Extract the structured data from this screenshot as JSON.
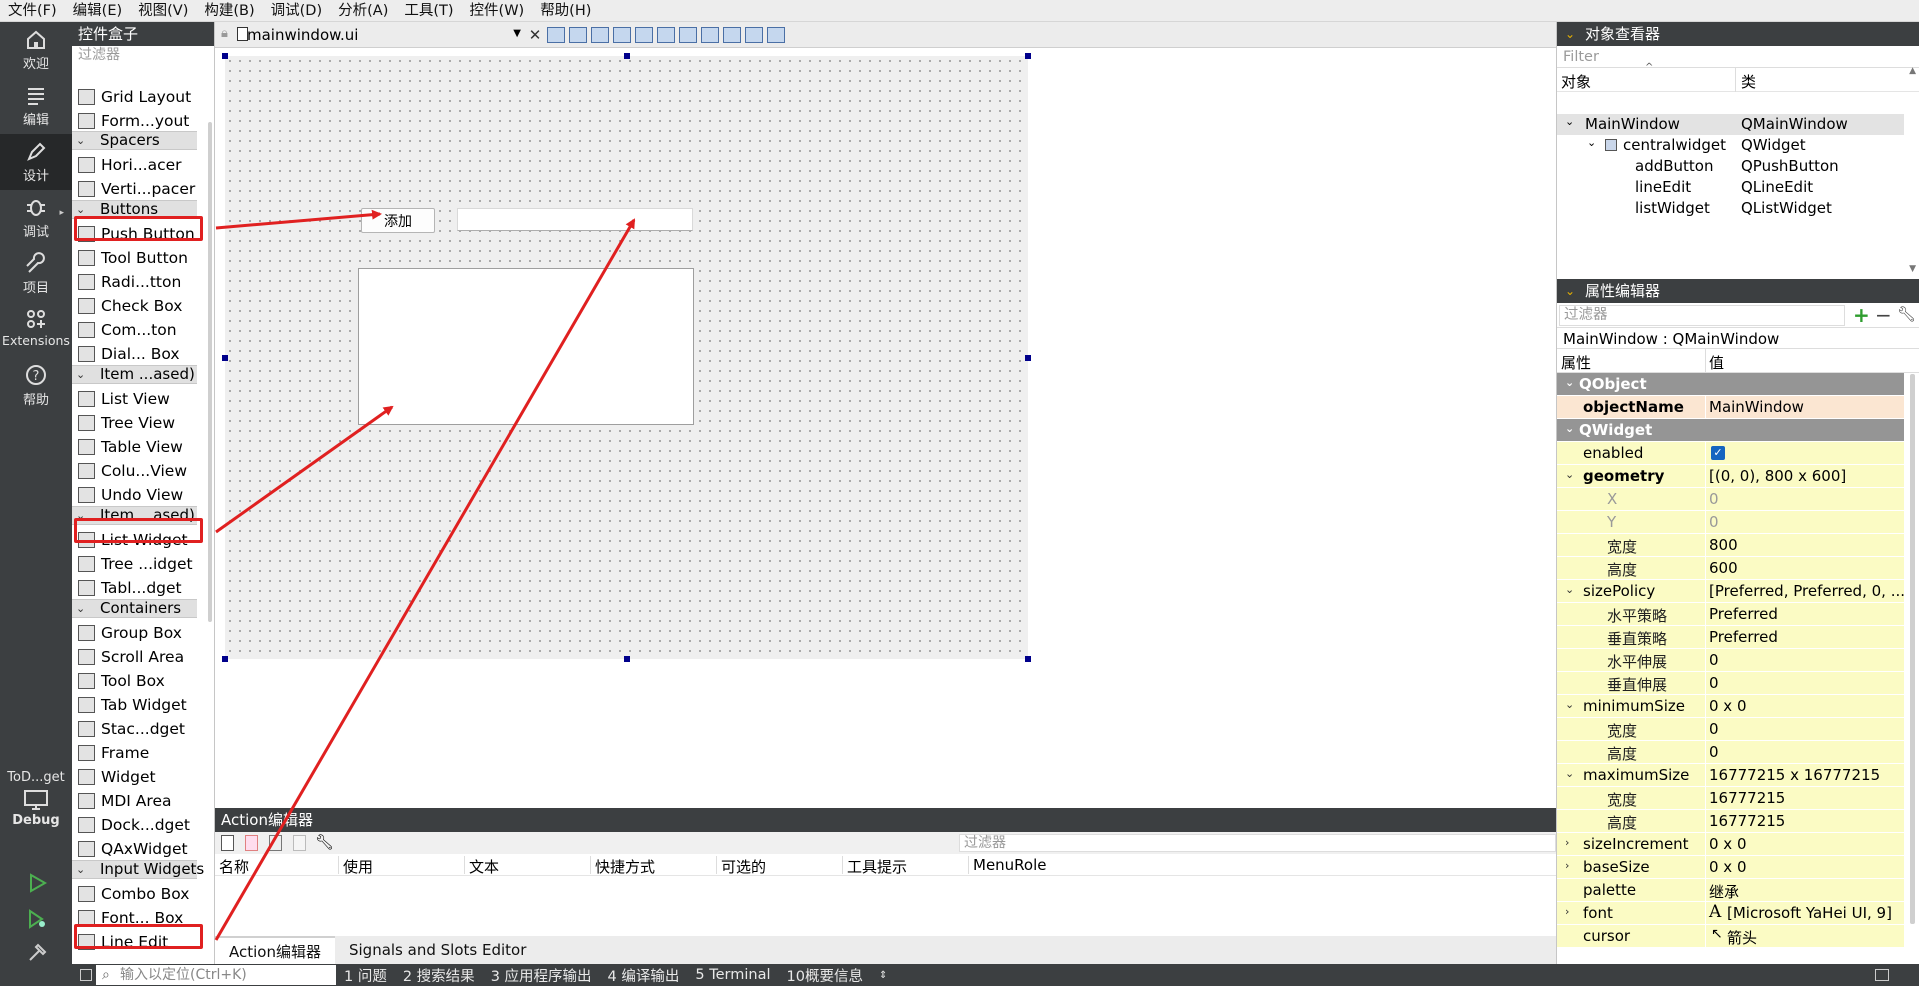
{
  "menubar": [
    "文件(F)",
    "编辑(E)",
    "视图(V)",
    "构建(B)",
    "调试(D)",
    "分析(A)",
    "工具(T)",
    "控件(W)",
    "帮助(H)"
  ],
  "modes": [
    {
      "label": "欢迎",
      "icon": "home-icon"
    },
    {
      "label": "编辑",
      "icon": "edit-lines-icon"
    },
    {
      "label": "设计",
      "icon": "pen-icon"
    },
    {
      "label": "调试",
      "icon": "bug-icon"
    },
    {
      "label": "项目",
      "icon": "wrench-icon"
    },
    {
      "label": "Extensions",
      "icon": "extensions-icon"
    },
    {
      "label": "帮助",
      "icon": "help-icon"
    }
  ],
  "kit": {
    "project": "ToD...get",
    "label": "Debug"
  },
  "widget_box": {
    "title": "控件盒子",
    "filter_placeholder": "过滤器",
    "items": [
      {
        "type": "item",
        "label": "Grid Layout",
        "icon": "grid-layout-icon"
      },
      {
        "type": "item",
        "label": "Form...yout",
        "icon": "form-layout-icon"
      },
      {
        "type": "cat",
        "label": "Spacers"
      },
      {
        "type": "item",
        "label": "Hori...acer",
        "icon": "horizontal-spacer-icon"
      },
      {
        "type": "item",
        "label": "Verti...pacer",
        "icon": "vertical-spacer-icon"
      },
      {
        "type": "cat",
        "label": "Buttons"
      },
      {
        "type": "item",
        "label": "Push Button",
        "icon": "push-button-icon"
      },
      {
        "type": "item",
        "label": "Tool Button",
        "icon": "tool-button-icon"
      },
      {
        "type": "item",
        "label": "Radi...tton",
        "icon": "radio-button-icon"
      },
      {
        "type": "item",
        "label": "Check Box",
        "icon": "check-box-icon"
      },
      {
        "type": "item",
        "label": "Com...ton",
        "icon": "command-link-icon"
      },
      {
        "type": "item",
        "label": "Dial... Box",
        "icon": "dialog-button-box-icon"
      },
      {
        "type": "cat",
        "label": "Item ...ased)"
      },
      {
        "type": "item",
        "label": "List View",
        "icon": "list-view-icon"
      },
      {
        "type": "item",
        "label": "Tree View",
        "icon": "tree-view-icon"
      },
      {
        "type": "item",
        "label": "Table View",
        "icon": "table-view-icon"
      },
      {
        "type": "item",
        "label": "Colu...View",
        "icon": "column-view-icon"
      },
      {
        "type": "item",
        "label": "Undo View",
        "icon": "undo-view-icon"
      },
      {
        "type": "cat",
        "label": "Item ...ased)"
      },
      {
        "type": "item",
        "label": "List Widget",
        "icon": "list-widget-icon"
      },
      {
        "type": "item",
        "label": "Tree ...idget",
        "icon": "tree-widget-icon"
      },
      {
        "type": "item",
        "label": "Tabl...dget",
        "icon": "table-widget-icon"
      },
      {
        "type": "cat",
        "label": "Containers"
      },
      {
        "type": "item",
        "label": "Group Box",
        "icon": "group-box-icon"
      },
      {
        "type": "item",
        "label": "Scroll Area",
        "icon": "scroll-area-icon"
      },
      {
        "type": "item",
        "label": "Tool Box",
        "icon": "tool-box-icon"
      },
      {
        "type": "item",
        "label": "Tab Widget",
        "icon": "tab-widget-icon"
      },
      {
        "type": "item",
        "label": "Stac...dget",
        "icon": "stacked-widget-icon"
      },
      {
        "type": "item",
        "label": "Frame",
        "icon": "frame-icon"
      },
      {
        "type": "item",
        "label": "Widget",
        "icon": "widget-icon"
      },
      {
        "type": "item",
        "label": "MDI Area",
        "icon": "mdi-area-icon"
      },
      {
        "type": "item",
        "label": "Dock...dget",
        "icon": "dock-widget-icon"
      },
      {
        "type": "item",
        "label": "QAxWidget",
        "icon": "qaxwidget-icon"
      },
      {
        "type": "cat",
        "label": "Input Widgets"
      },
      {
        "type": "item",
        "label": "Combo Box",
        "icon": "combo-box-icon"
      },
      {
        "type": "item",
        "label": "Font... Box",
        "icon": "font-combo-box-icon"
      },
      {
        "type": "item",
        "label": "Line Edit",
        "icon": "line-edit-icon"
      }
    ]
  },
  "editor": {
    "file": "mainwindow.ui"
  },
  "form": {
    "add_button_label": "添加"
  },
  "action_editor": {
    "title": "Action编辑器",
    "filter_placeholder": "过滤器",
    "columns": [
      "名称",
      "使用",
      "文本",
      "快捷方式",
      "可选的",
      "工具提示",
      "MenuRole"
    ],
    "tabs": [
      "Action编辑器",
      "Signals and Slots Editor"
    ]
  },
  "object_inspector": {
    "title": "对象查看器",
    "filter_placeholder": "Filter",
    "columns": [
      "对象",
      "类"
    ],
    "rows": [
      {
        "name": "MainWindow",
        "class": "QMainWindow"
      },
      {
        "name": "centralwidget",
        "class": "QWidget"
      },
      {
        "name": "addButton",
        "class": "QPushButton"
      },
      {
        "name": "lineEdit",
        "class": "QLineEdit"
      },
      {
        "name": "listWidget",
        "class": "QListWidget"
      }
    ]
  },
  "property_editor": {
    "title": "属性编辑器",
    "filter_placeholder": "过滤器",
    "object": "MainWindow : QMainWindow",
    "columns": [
      "属性",
      "值"
    ],
    "rows": [
      {
        "kind": "group",
        "name": "QObject",
        "value": ""
      },
      {
        "kind": "obj",
        "name": "objectName",
        "value": "MainWindow"
      },
      {
        "kind": "group",
        "name": "QWidget",
        "value": ""
      },
      {
        "kind": "wid",
        "name": "enabled",
        "value": ""
      },
      {
        "kind": "wid",
        "name": "geometry",
        "value": "[(0, 0), 800 x 600]"
      },
      {
        "kind": "wid",
        "name": "X",
        "value": "0"
      },
      {
        "kind": "wid",
        "name": "Y",
        "value": "0"
      },
      {
        "kind": "wid",
        "name": "宽度",
        "value": "800"
      },
      {
        "kind": "wid",
        "name": "高度",
        "value": "600"
      },
      {
        "kind": "wid",
        "name": "sizePolicy",
        "value": "[Preferred, Preferred, 0, ..."
      },
      {
        "kind": "wid",
        "name": "水平策略",
        "value": "Preferred"
      },
      {
        "kind": "wid",
        "name": "垂直策略",
        "value": "Preferred"
      },
      {
        "kind": "wid",
        "name": "水平伸展",
        "value": "0"
      },
      {
        "kind": "wid",
        "name": "垂直伸展",
        "value": "0"
      },
      {
        "kind": "wid",
        "name": "minimumSize",
        "value": "0 x 0"
      },
      {
        "kind": "wid",
        "name": "宽度",
        "value": "0"
      },
      {
        "kind": "wid",
        "name": "高度",
        "value": "0"
      },
      {
        "kind": "wid",
        "name": "maximumSize",
        "value": "16777215 x 16777215"
      },
      {
        "kind": "wid",
        "name": "宽度",
        "value": "16777215"
      },
      {
        "kind": "wid",
        "name": "高度",
        "value": "16777215"
      },
      {
        "kind": "wid",
        "name": "sizeIncrement",
        "value": "0 x 0"
      },
      {
        "kind": "wid",
        "name": "baseSize",
        "value": "0 x 0"
      },
      {
        "kind": "wid",
        "name": "palette",
        "value": "继承"
      },
      {
        "kind": "wid",
        "name": "font",
        "value": "[Microsoft YaHei UI, 9]"
      },
      {
        "kind": "wid",
        "name": "cursor",
        "value": "箭头"
      }
    ]
  },
  "statusbar": {
    "locator_placeholder": "输入以定位(Ctrl+K)",
    "panes": [
      "1 问题",
      "2 搜索结果",
      "3 应用程序输出",
      "4 编译输出",
      "5 Terminal",
      "10概要信息"
    ]
  },
  "colors": {
    "accent": "#e02020",
    "handles": "#00008b",
    "sidebar": "#3c3f41"
  }
}
